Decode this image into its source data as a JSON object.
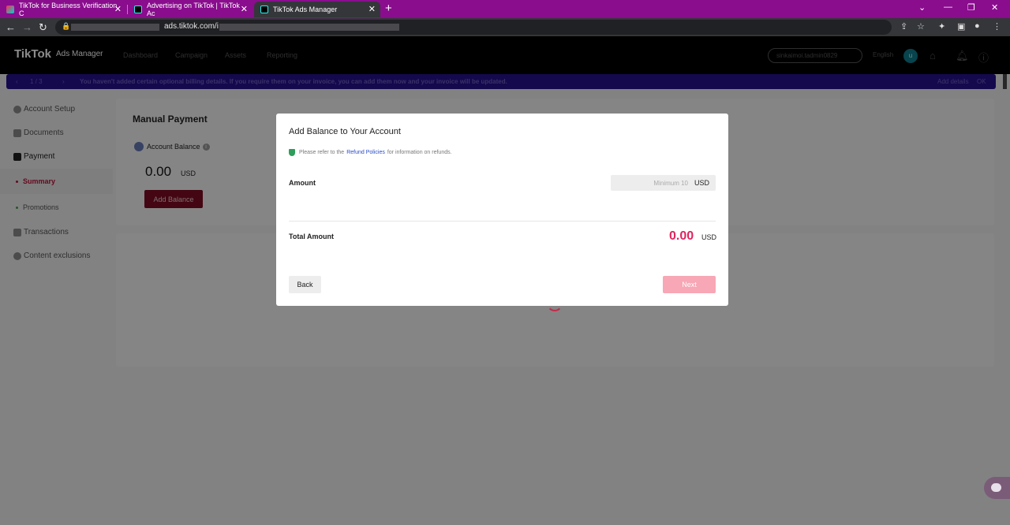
{
  "browser": {
    "tabs": [
      {
        "title": "TikTok for Business Verification C",
        "active": false
      },
      {
        "title": "Advertising on TikTok | TikTok Ac",
        "active": false
      },
      {
        "title": "TikTok Ads Manager",
        "active": true
      }
    ],
    "new_tab_label": "+",
    "url": "ads.tiktok.com/i"
  },
  "app": {
    "logo": "TikTok",
    "logo_sub": "Ads Manager",
    "nav": [
      "Dashboard",
      "Campaign",
      "Assets",
      "Reporting"
    ],
    "account": "sinkaimoi.tadmin0829",
    "language": "English",
    "avatar_initial": "u"
  },
  "banner": {
    "pager": "1 / 3",
    "message": "You haven't added certain optional billing details. If you require them on your invoice, you can add them now and your invoice will be updated.",
    "add_details": "Add details",
    "ok": "OK"
  },
  "sidebar": {
    "items": [
      {
        "label": "Account Setup"
      },
      {
        "label": "Documents"
      },
      {
        "label": "Payment"
      },
      {
        "label": "Summary"
      },
      {
        "label": "Promotions"
      },
      {
        "label": "Transactions"
      },
      {
        "label": "Content exclusions"
      }
    ]
  },
  "manual_payment": {
    "title": "Manual Payment",
    "balance_label": "Account Balance",
    "balance_amount": "0.00",
    "balance_currency": "USD",
    "add_balance_label": "Add Balance"
  },
  "modal": {
    "title": "Add Balance to Your Account",
    "note_before": "Please refer to the",
    "note_link": "Refund Policies",
    "note_after": "for information on refunds.",
    "amount_label": "Amount",
    "amount_placeholder": "Minimum 10",
    "amount_value": "",
    "amount_currency": "USD",
    "total_label": "Total Amount",
    "total_amount": "0.00",
    "total_currency": "USD",
    "back_label": "Back",
    "next_label": "Next"
  },
  "colors": {
    "tab_strip": "#8a0d8e",
    "banner": "#26118c",
    "add_balance": "#7a0b22",
    "total_accent": "#e0245e",
    "next_disabled": "#f7a7b5"
  }
}
